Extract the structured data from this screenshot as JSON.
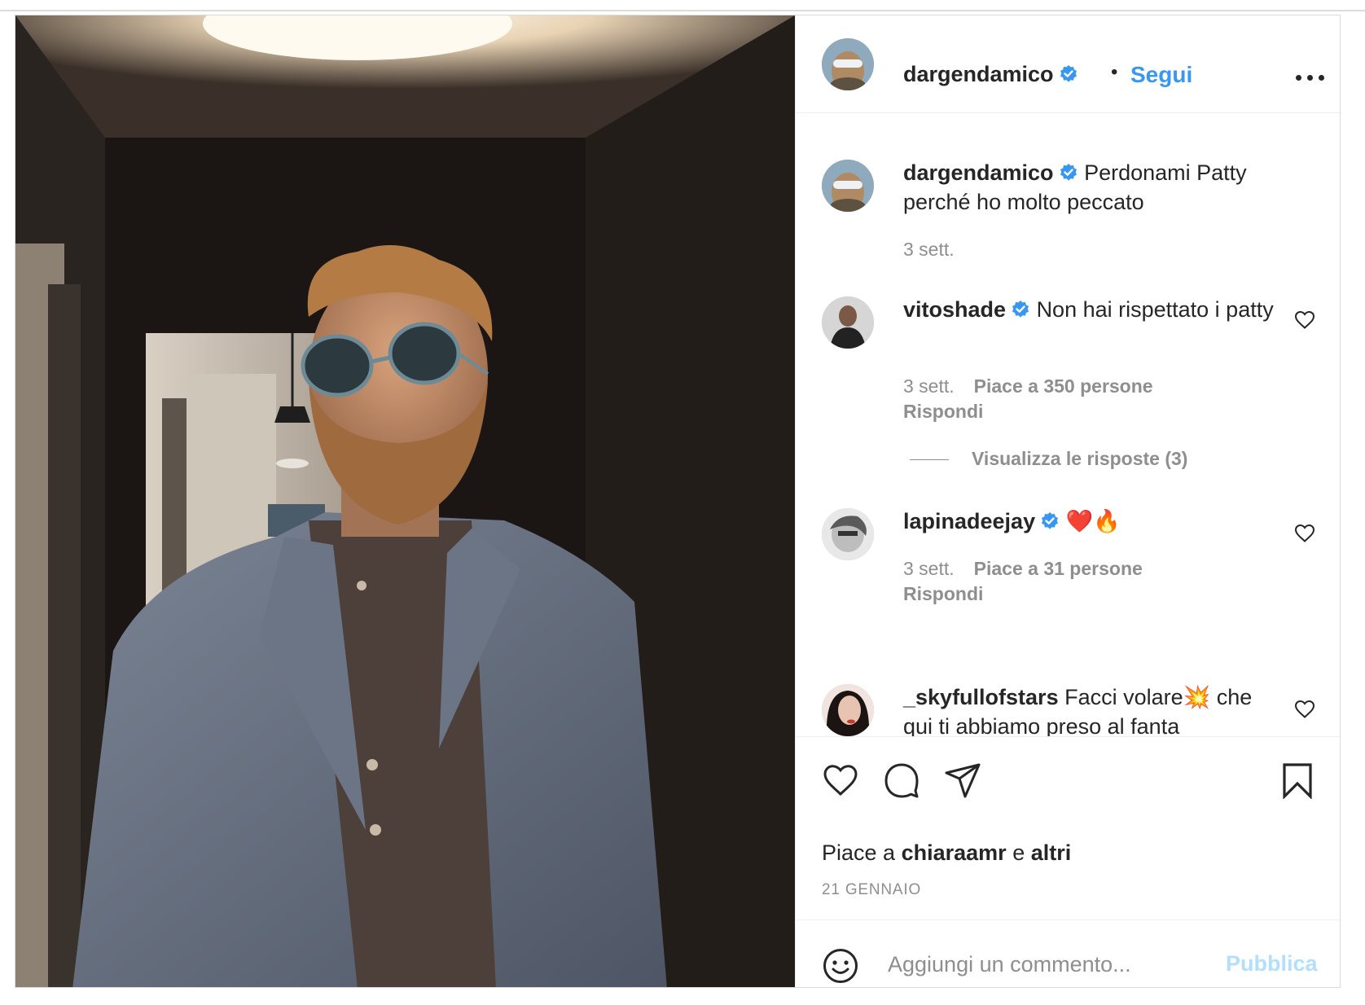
{
  "post": {
    "username": "dargendamico",
    "follow_label": "Segui",
    "separator": "•",
    "more_icon": "more-horizontal-icon"
  },
  "caption": {
    "username": "dargendamico",
    "text": "Perdonami Patty perché ho molto peccato",
    "time": "3 sett."
  },
  "comments": [
    {
      "username": "vitoshade",
      "text": "Non hai rispettato i patty",
      "time": "3 sett.",
      "likes": "Piace a 350 persone",
      "reply": "Rispondi",
      "view_replies": "Visualizza le risposte (3)"
    },
    {
      "username": "lapinadeejay",
      "text": "❤️🔥",
      "time": "3 sett.",
      "likes": "Piace a 31 persone",
      "reply": "Rispondi"
    },
    {
      "username": "_skyfullofstars",
      "text": "Facci volare💥 che qui ti abbiamo preso al fanta"
    }
  ],
  "liked_by": {
    "prefix": "Piace a",
    "user": "chiaraamr",
    "conj": "e",
    "others": "altri"
  },
  "date": "21 GENNAIO",
  "composer": {
    "placeholder": "Aggiungi un commento...",
    "publish_label": "Pubblica"
  },
  "colors": {
    "link_blue": "#3897f0",
    "publish_disabled": "#b2dffc",
    "verified": "#3897f0",
    "secondary_text": "#8e8e8e"
  }
}
